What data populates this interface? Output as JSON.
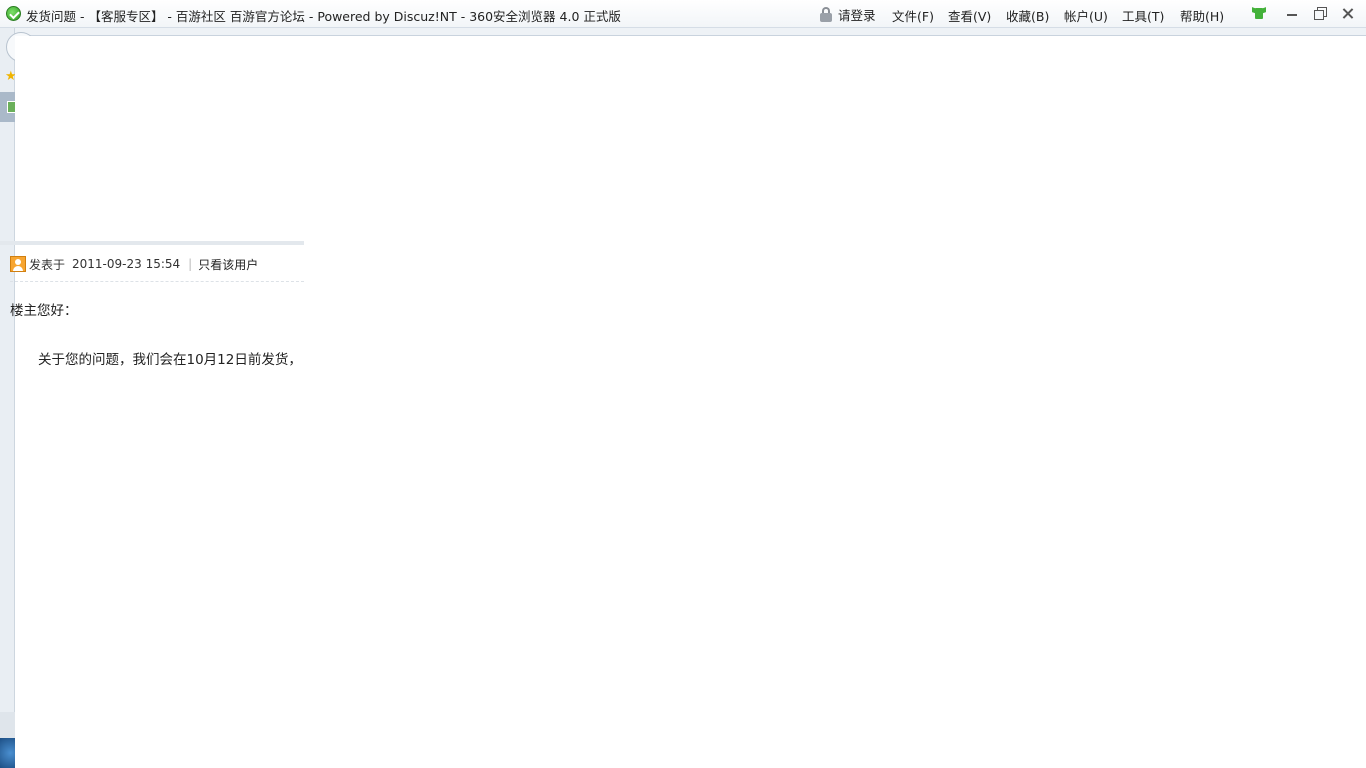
{
  "window": {
    "title": "发货问题 - 【客服专区】 - 百游社区 百游官方论坛 - Powered by Discuz!NT - 360安全浏览器 4.0 正式版",
    "login_label": "请登录",
    "menu": [
      {
        "label": "文件(F)"
      },
      {
        "label": "查看(V)"
      },
      {
        "label": "收藏(B)"
      },
      {
        "label": "帐户(U)"
      },
      {
        "label": "工具(T)"
      },
      {
        "label": "帮助(H)"
      }
    ]
  },
  "post": {
    "meta_prefix": "发表于",
    "timestamp": "2011-09-23 15:54",
    "separator": "|",
    "only_user_link": "只看该用户",
    "greeting": "楼主您好：",
    "body": "关于您的问题，我们会在10月12日前发货，"
  },
  "colors": {
    "title_bar": "#f6f8fa",
    "logo_green": "#2a9a1e",
    "user_icon_orange": "#f7a531",
    "skin_icon_green": "#43b13a"
  }
}
